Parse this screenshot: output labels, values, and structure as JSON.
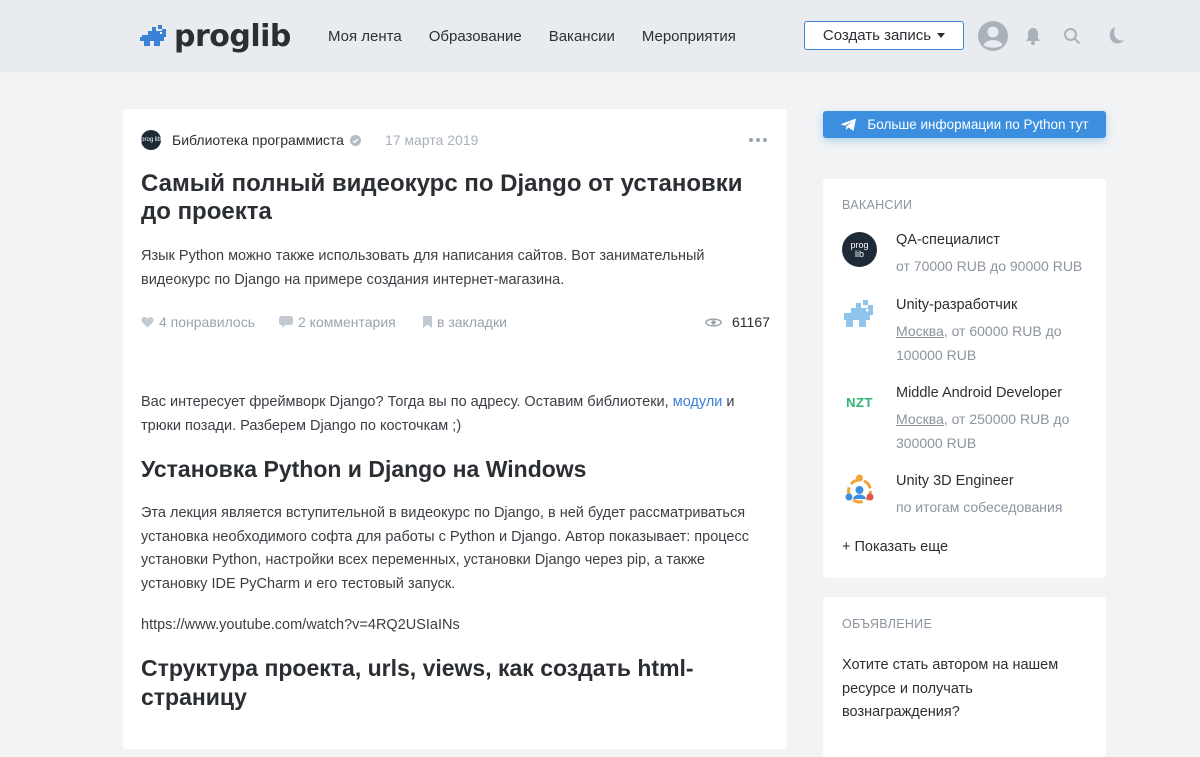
{
  "header": {
    "logo_text": "proglib",
    "nav": [
      "Моя лента",
      "Образование",
      "Вакансии",
      "Мероприятия"
    ],
    "create_label": "Создать запись",
    "icons": [
      "user-avatar-icon",
      "bell-icon",
      "search-icon",
      "moon-icon"
    ]
  },
  "article": {
    "source_avatar": "prog lib",
    "source_name": "Библиотека программиста",
    "date": "17 марта 2019",
    "title": "Самый полный видеокурс по Django от установки до проекта",
    "lead": "Язык Python можно также использовать для написания сайтов. Вот занимательный видеокурс по Django на примере создания интернет-магазина.",
    "likes": "4 понравилось",
    "comments": "2 комментария",
    "bookmarks": "в закладки",
    "views": "61167",
    "intro_before": "Вас интересует фреймворк Django? Тогда вы по адресу. Оставим библиотеки, ",
    "intro_link": "модули",
    "intro_after": " и трюки позади. Разберем Django по косточкам ;)",
    "h2_1": "Установка Python и Django на Windows",
    "p1": "Эта лекция является вступительной в видеокурс по Django, в ней будет рассматриваться установка необходимого софта для работы с Python и Django. Автор показывает: процесс установки Python, настройки всех переменных, установки Django через pip, а также установку IDE PyCharm и его тестовый запуск.",
    "link1": "https://www.youtube.com/watch?v=4RQ2USIaINs",
    "h2_2": "Структура проекта, urls, views, как создать html-страницу"
  },
  "sidebar": {
    "telegram_label": "Больше информации по Python тут",
    "jobs_label": "ВАКАНСИИ",
    "jobs": [
      {
        "title": "QA-специалист",
        "city": "",
        "salary": "от 70000 RUB до 90000 RUB",
        "logo_text": "prog lib"
      },
      {
        "title": "Unity-разработчик",
        "city": "Москва",
        "salary": ", от 60000 RUB до 100000 RUB",
        "logo_text": ""
      },
      {
        "title": "Middle Android Developer",
        "city": "Москва",
        "salary": ", от 250000 RUB до 300000 RUB",
        "logo_text": "NZT"
      },
      {
        "title": "Unity 3D Engineer",
        "city": "",
        "salary": "по итогам собеседования",
        "logo_text": ""
      }
    ],
    "show_more": "+ Показать еще",
    "ad_label": "ОБЪЯВЛЕНИЕ",
    "ad_text": "Хотите стать автором на нашем ресурсе и получать вознаграждения?"
  },
  "colors": {
    "accent": "#3b82d6",
    "telegram": "#3b8fde",
    "nzt": "#2bb673"
  }
}
